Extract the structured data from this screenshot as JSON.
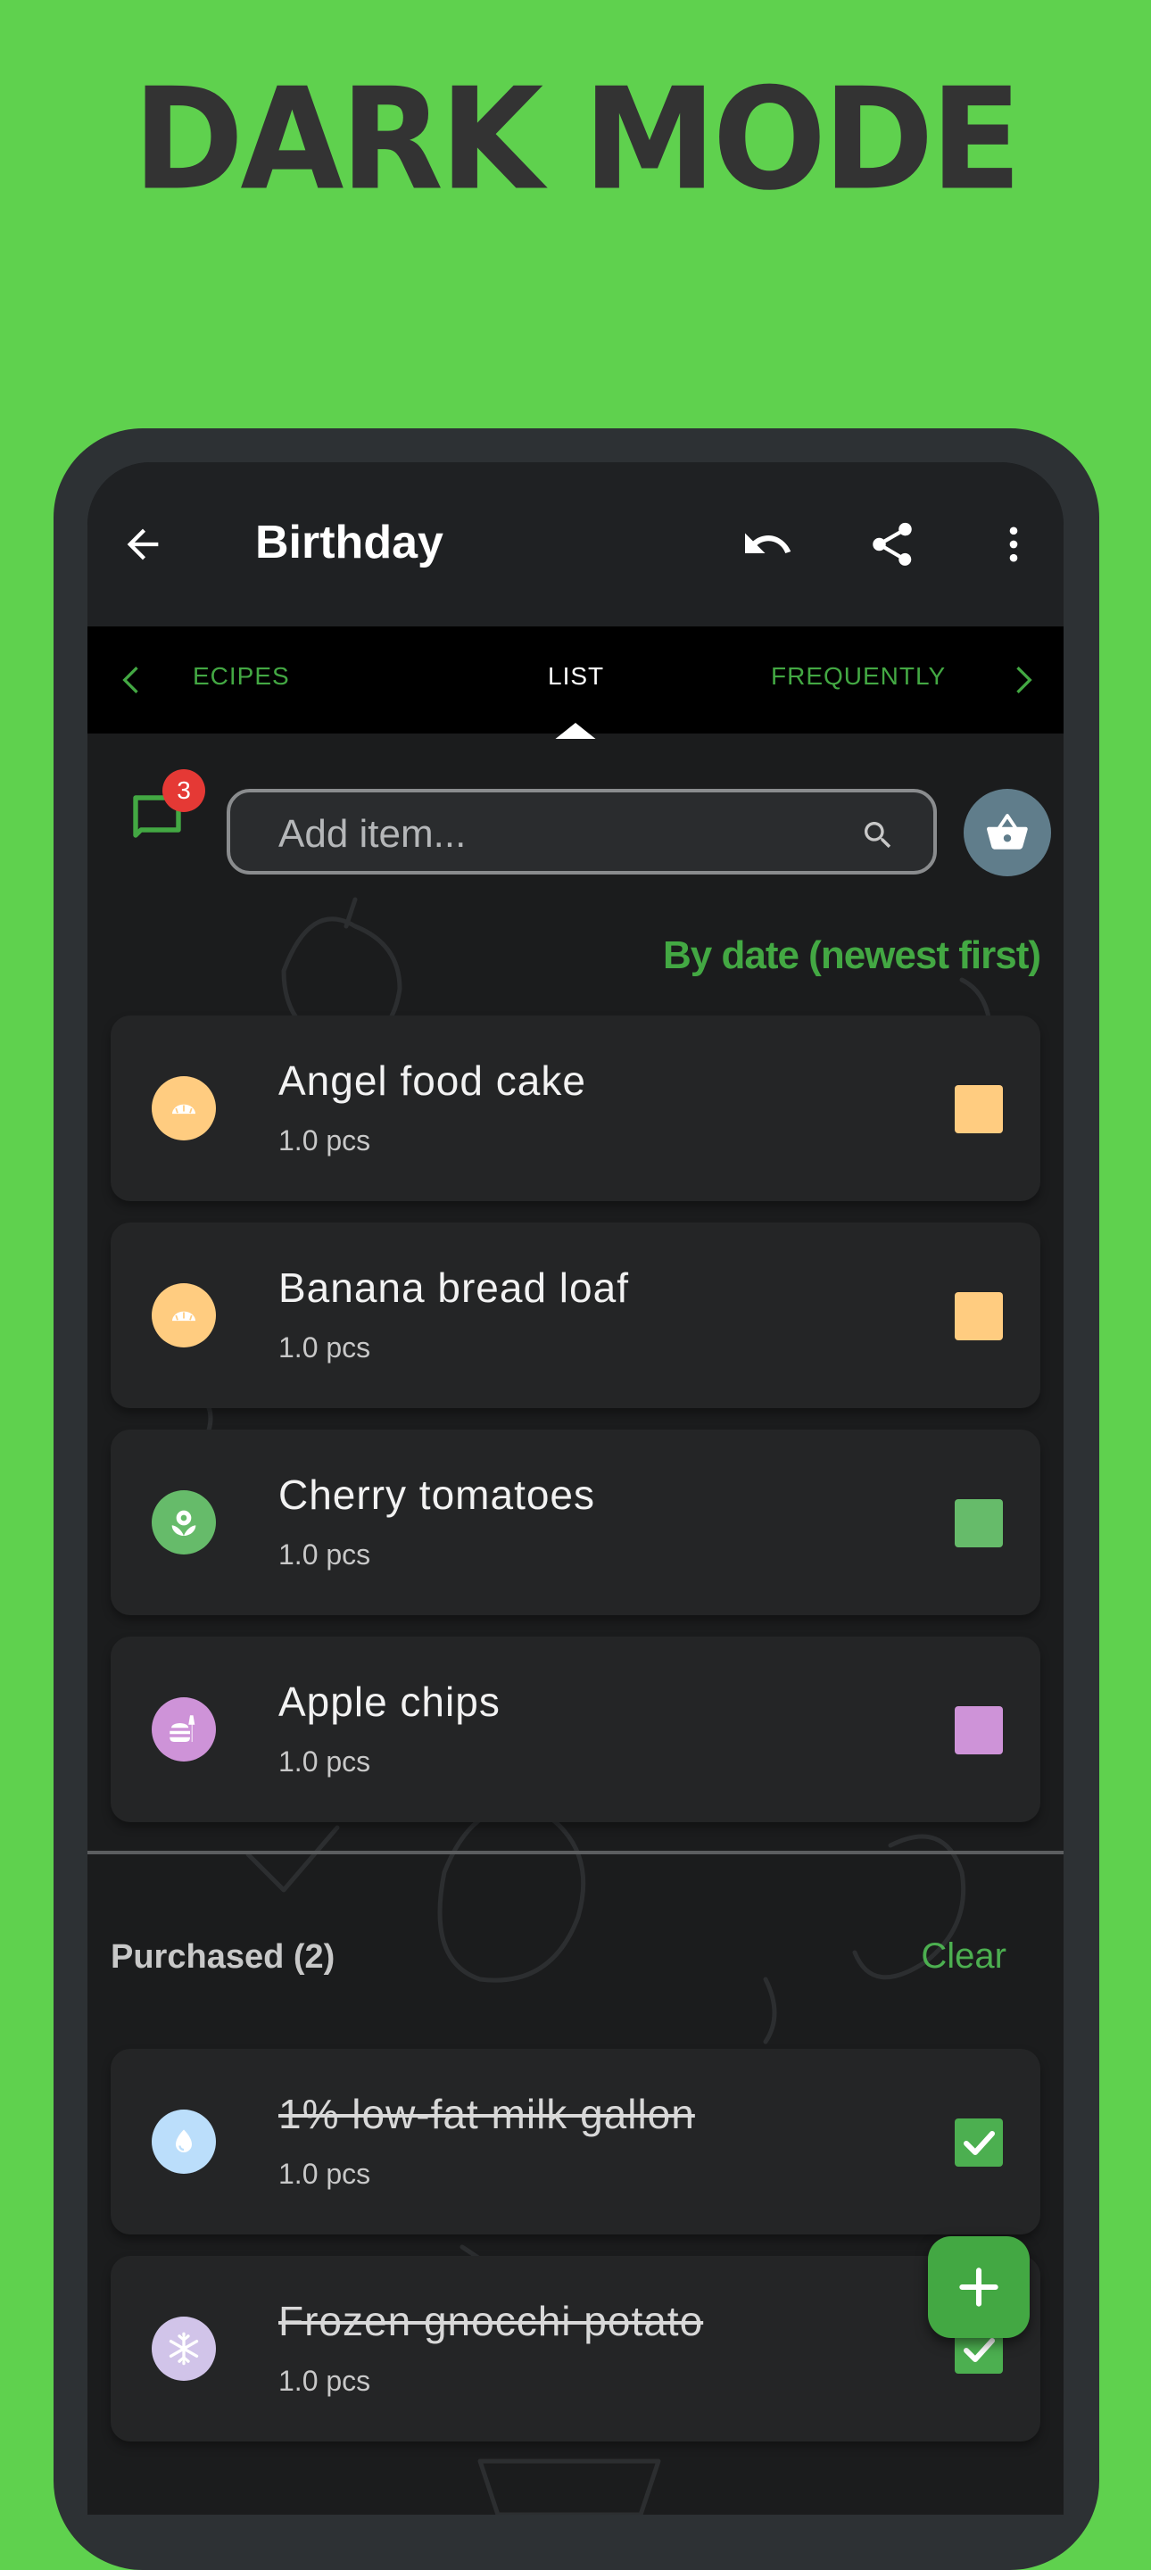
{
  "headline": "DARK MODE",
  "appbar": {
    "title": "Birthday",
    "back_icon": "arrow-back-icon",
    "undo_icon": "undo-icon",
    "share_icon": "share-icon",
    "menu_icon": "more-vert-icon"
  },
  "tabs": {
    "items": [
      {
        "label": "ECIPES",
        "active": false
      },
      {
        "label": "LIST",
        "active": true
      },
      {
        "label": "FREQUENTLY",
        "active": false
      }
    ],
    "prev_icon": "chevron-left-icon",
    "next_icon": "chevron-right-icon"
  },
  "search": {
    "placeholder": "Add item...",
    "chat_badge": "3",
    "chat_icon": "chat-icon",
    "search_icon": "search-icon",
    "basket_icon": "basket-icon"
  },
  "sort_label": "By date (newest first)",
  "items": [
    {
      "name": "Angel food cake",
      "qty": "1.0 pcs",
      "category_icon": "bakery-icon",
      "color": "#ffcc80"
    },
    {
      "name": "Banana bread loaf",
      "qty": "1.0 pcs",
      "category_icon": "bakery-icon",
      "color": "#ffcc80"
    },
    {
      "name": "Cherry tomatoes",
      "qty": "1.0 pcs",
      "category_icon": "produce-icon",
      "color": "#66bb6a"
    },
    {
      "name": "Apple chips",
      "qty": "1.0 pcs",
      "category_icon": "snacks-icon",
      "color": "#ce93d8"
    }
  ],
  "purchased": {
    "label": "Purchased (2)",
    "clear_label": "Clear",
    "items": [
      {
        "name": "1% low-fat milk gallon",
        "qty": "1.0 pcs",
        "category_icon": "dairy-icon",
        "color": "#bbdefb"
      },
      {
        "name": "Frozen gnocchi potato",
        "qty": "1.0 pcs",
        "category_icon": "frozen-icon",
        "color": "#d1c4e9"
      }
    ]
  },
  "fab_icon": "add-icon",
  "colors": {
    "background": "#5fd14e",
    "accent": "#43a843",
    "badge": "#e53935",
    "basket": "#607d8b"
  }
}
